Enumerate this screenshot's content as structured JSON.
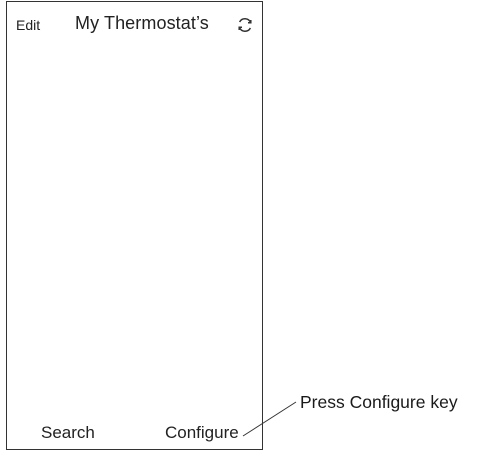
{
  "header": {
    "edit_label": "Edit",
    "title": "My Thermostat’s",
    "refresh_icon": "refresh-icon"
  },
  "footer": {
    "search_label": "Search",
    "configure_label": "Configure"
  },
  "annotation": {
    "text": "Press Configure key"
  },
  "colors": {
    "border": "#333333",
    "text": "#1a1a1a",
    "background": "#ffffff"
  }
}
